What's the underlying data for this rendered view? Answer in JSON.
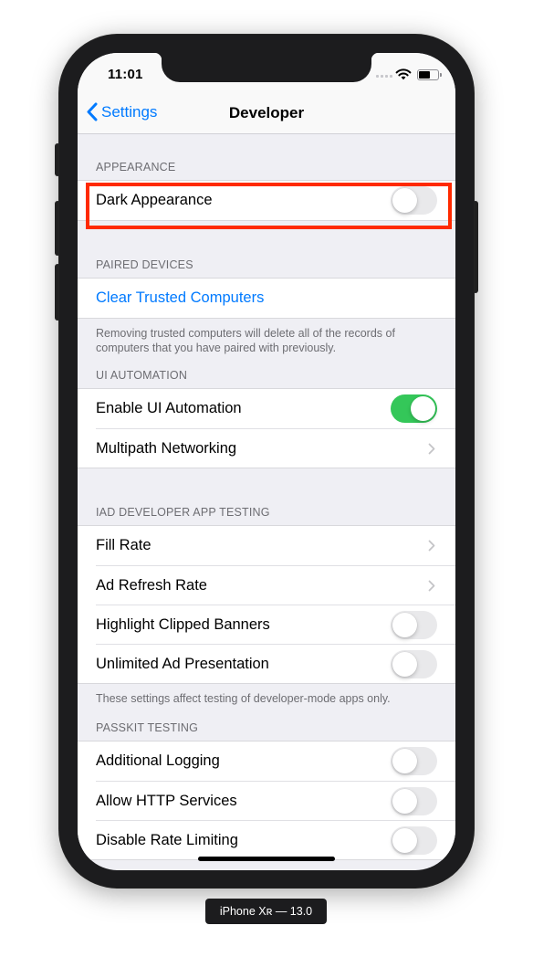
{
  "device": {
    "label": "iPhone Xʀ — 13.0"
  },
  "status_bar": {
    "time": "11:01",
    "icons": [
      "signal-dots-icon",
      "wifi-icon",
      "battery-icon"
    ]
  },
  "nav": {
    "back_label": "Settings",
    "title": "Developer"
  },
  "colors": {
    "accent": "#007aff",
    "toggle_on": "#34c759",
    "highlight": "#ff2a00"
  },
  "sections": [
    {
      "header": "Appearance",
      "rows": [
        {
          "label": "Dark Appearance",
          "type": "toggle",
          "on": false,
          "highlighted": true
        }
      ]
    },
    {
      "header": "Paired Devices",
      "rows": [
        {
          "label": "Clear Trusted Computers",
          "type": "link"
        }
      ],
      "footer": "Removing trusted computers will delete all of the records of computers that you have paired with previously."
    },
    {
      "header": "UI Automation",
      "rows": [
        {
          "label": "Enable UI Automation",
          "type": "toggle",
          "on": true
        },
        {
          "label": "Multipath Networking",
          "type": "disclosure"
        }
      ]
    },
    {
      "header": "IAD Developer App Testing",
      "rows": [
        {
          "label": "Fill Rate",
          "type": "disclosure"
        },
        {
          "label": "Ad Refresh Rate",
          "type": "disclosure"
        },
        {
          "label": "Highlight Clipped Banners",
          "type": "toggle",
          "on": false
        },
        {
          "label": "Unlimited Ad Presentation",
          "type": "toggle",
          "on": false
        }
      ],
      "footer": "These settings affect testing of developer-mode apps only."
    },
    {
      "header": "PassKit Testing",
      "rows": [
        {
          "label": "Additional Logging",
          "type": "toggle",
          "on": false
        },
        {
          "label": "Allow HTTP Services",
          "type": "toggle",
          "on": false
        },
        {
          "label": "Disable Rate Limiting",
          "type": "toggle",
          "on": false
        }
      ]
    }
  ]
}
